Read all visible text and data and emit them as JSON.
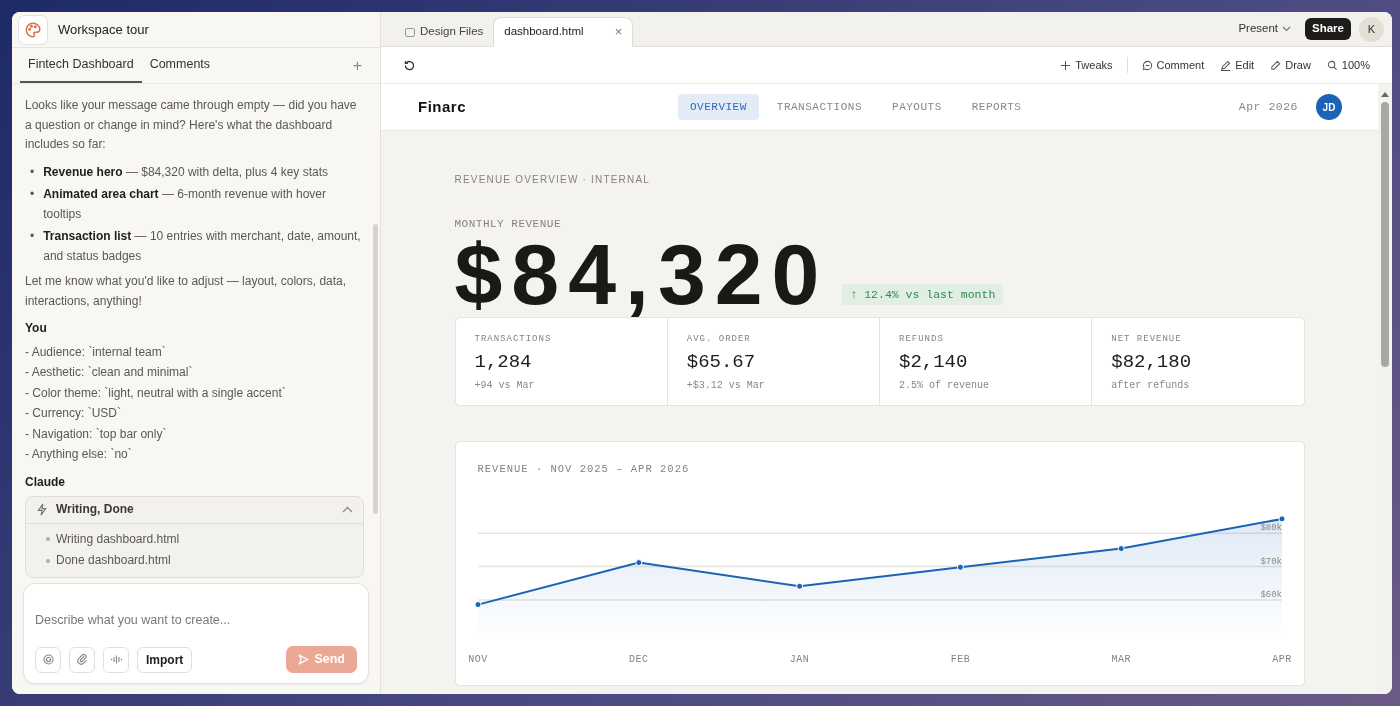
{
  "window": {
    "title": "Workspace tour"
  },
  "panel_tabs": [
    {
      "label": "Fintech Dashboard",
      "selected": true
    },
    {
      "label": "Comments",
      "selected": false
    }
  ],
  "add_tab": "+",
  "chat": {
    "intro": "Looks like your message came through empty — did you have a question or change in mind? Here's what the dashboard includes so far:",
    "bullets": [
      {
        "marker": "•",
        "text": "**Revenue hero** — $84,320 with delta, plus 4 key stats"
      },
      {
        "marker": "•",
        "text": "**Animated area chart** — 6-month revenue with hover tooltips"
      },
      {
        "marker": "•",
        "text": "**Transaction list** — 10 entries with merchant, date, amount, and status badges"
      }
    ],
    "outro": "Let me know what you'd like to adjust — layout, colors, data, interactions, anything!",
    "user": {
      "author": "You",
      "lines": [
        "- Audience: `internal team`",
        "- Aesthetic: `clean and minimal`",
        "- Color theme: `light, neutral with a single accent`",
        "- Currency: `USD`",
        "- Navigation: `top bar only`",
        "- Anything else: `no`"
      ]
    },
    "assistant": {
      "author": "Claude",
      "tool_group": {
        "title": "Writing, Done",
        "expanded": true,
        "items": [
          "Writing dashboard.html",
          "Done dashboard.html"
        ]
      }
    }
  },
  "composer": {
    "placeholder": "Describe what you want to create...",
    "import_label": "Import",
    "send_label": "Send",
    "send_disabled": true
  },
  "file_tabs": [
    {
      "label": "Design Files",
      "selected": false
    },
    {
      "label": "dashboard.html",
      "selected": true,
      "close": "×"
    }
  ],
  "present_label": "Present",
  "share_label": "Share",
  "user_avatar": "K",
  "toolbar": [
    {
      "kind": "plus",
      "label": "Tweaks"
    },
    {
      "kind": "comment",
      "label": "Comment"
    },
    {
      "kind": "edit",
      "label": "Edit"
    },
    {
      "kind": "draw",
      "label": "Draw"
    },
    {
      "kind": "zoom",
      "label": "100%"
    }
  ],
  "dashboard": {
    "brand": "Finarc",
    "nav": [
      {
        "label": "OVERVIEW",
        "selected": true
      },
      {
        "label": "TRANSACTIONS",
        "selected": false
      },
      {
        "label": "PAYOUTS",
        "selected": false
      },
      {
        "label": "REPORTS",
        "selected": false
      }
    ],
    "date": "Apr 2026",
    "avatar": "JD",
    "eyebrow": "REVENUE OVERVIEW · INTERNAL",
    "metric_label": "MONTHLY REVENUE",
    "total": "$84,320",
    "delta": "↑ 12.4% vs last month",
    "stats": [
      {
        "label": "TRANSACTIONS",
        "value": "1,284",
        "note": "+94 vs Mar"
      },
      {
        "label": "AVG. ORDER",
        "value": "$65.67",
        "note": "+$3.12 vs Mar"
      },
      {
        "label": "REFUNDS",
        "value": "$2,140",
        "note": "2.5% of revenue"
      },
      {
        "label": "NET REVENUE",
        "value": "$82,180",
        "note": "after refunds"
      }
    ],
    "chart": {
      "chart_data": {
        "type": "area",
        "title": "REVENUE · NOV 2025 – APR 2026",
        "categories": [
          "NOV",
          "DEC",
          "JAN",
          "FEB",
          "MAR",
          "APR"
        ],
        "series": [
          {
            "color": "#1b63b5",
            "values": [
              58600,
              71200,
              64100,
              69800,
              75400,
              84320
            ]
          }
        ],
        "grid": true,
        "ylim": [
          34100,
          107600
        ],
        "yticks": [
          {
            "value": 60000,
            "label": "$60k"
          },
          {
            "value": 70000,
            "label": "$70k"
          },
          {
            "value": 80000,
            "label": "$80k"
          }
        ]
      }
    }
  }
}
